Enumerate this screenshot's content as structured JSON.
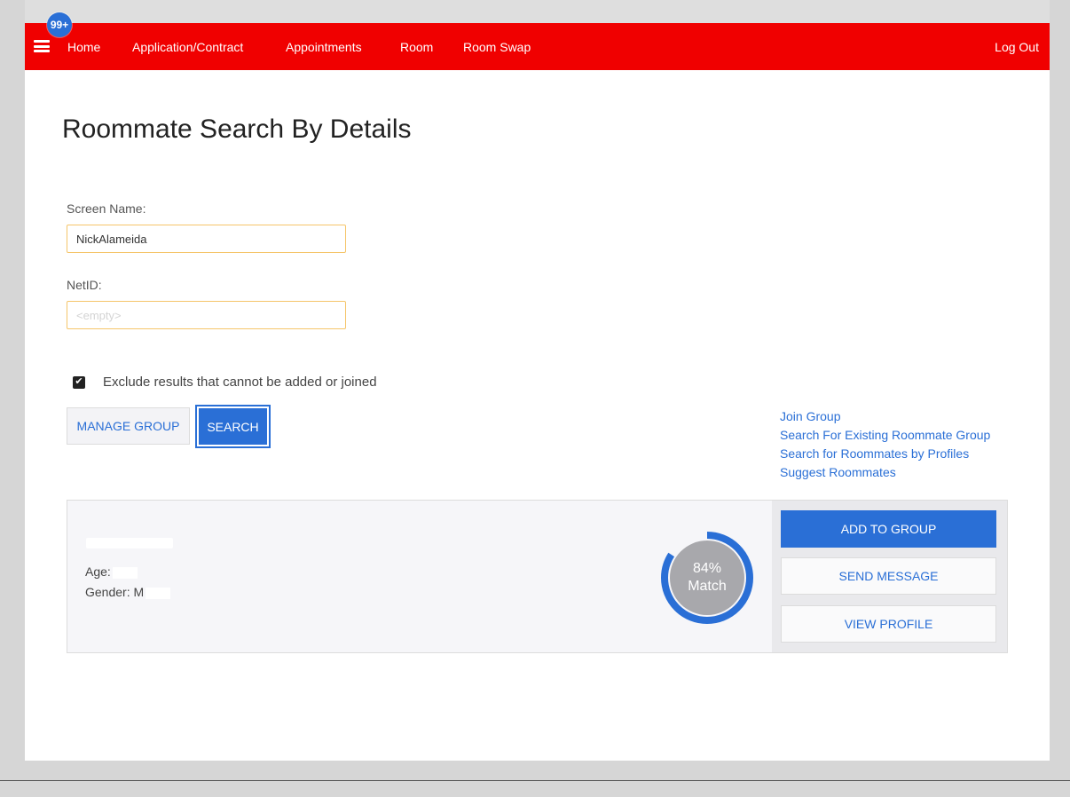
{
  "nav": {
    "badge": "99+",
    "items": [
      "Home",
      "Application/Contract",
      "Appointments",
      "Room",
      "Room Swap"
    ],
    "logout": "Log Out",
    "color": "#f00000"
  },
  "page_title": "Roommate Search By Details",
  "form": {
    "screen_name_label": "Screen Name:",
    "screen_name_value": "NickAlameida",
    "netid_label": "NetID:",
    "netid_placeholder": "<empty>",
    "exclude_label": "Exclude results that cannot be added or joined",
    "exclude_checked": true,
    "manage_group": "MANAGE GROUP",
    "search": "SEARCH"
  },
  "links": [
    "Join Group",
    "Search For Existing Roommate Group",
    "Search for Roommates by Profiles",
    "Suggest Roommates"
  ],
  "result": {
    "age_label": "Age:",
    "gender_label": "Gender:",
    "gender_initial": "M",
    "match_percent": "84%",
    "match_word": "Match",
    "match_fraction": 0.84,
    "actions": {
      "add": "ADD TO GROUP",
      "message": "SEND MESSAGE",
      "profile": "VIEW PROFILE"
    }
  },
  "colors": {
    "accent": "#2a6fd6",
    "field_border": "#f5c56a"
  }
}
